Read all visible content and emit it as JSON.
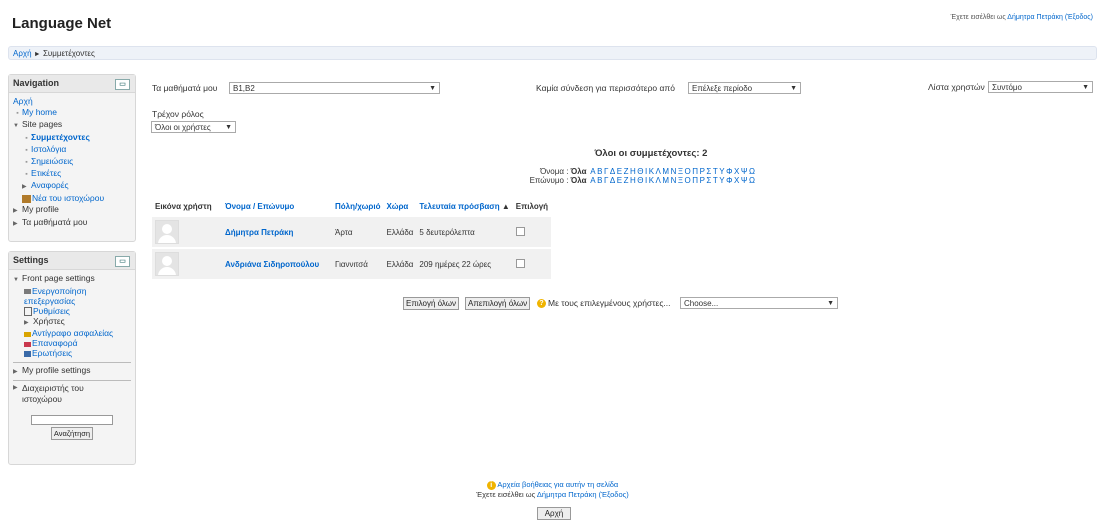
{
  "header": {
    "site_title": "Language Net",
    "login_prefix": "Έχετε εισέλθει ως",
    "login_user": "Δήμητρα Πετράκη",
    "logout": "(Έξοδος)"
  },
  "breadcrumb": {
    "home": "Αρχή",
    "sep": "►",
    "current": "Συμμετέχοντες"
  },
  "navigation": {
    "title": "Navigation",
    "home": "Αρχή",
    "my_home": "My home",
    "site_pages": "Site pages",
    "site_items": [
      "Συμμετέχοντες",
      "Ιστολόγια",
      "Σημειώσεις",
      "Ετικέτες",
      "Αναφορές",
      "Νέα του ιστοχώρου"
    ],
    "my_profile": "My profile",
    "my_courses": "Τα μαθήματά μου"
  },
  "settings": {
    "title": "Settings",
    "front_page_settings": "Front page settings",
    "items": [
      "Ενεργοποίηση επεξεργασίας",
      "Ρυθμίσεις",
      "Χρήστες",
      "Αντίγραφο ασφαλείας",
      "Επαναφορά",
      "Ερωτήσεις"
    ],
    "my_profile_settings": "My profile settings",
    "site_admin": "Διαχειριστής του ιστοχώρου",
    "search_button": "Αναζήτηση",
    "search_value": ""
  },
  "filters": {
    "courses_label": "Τα μαθήματά μου",
    "courses_value": "B1,B2",
    "inactive_label": "Καμία σύνδεση για περισσότερο από",
    "inactive_value": "Επέλεξε περίοδο",
    "userlist_label": "Λίστα χρηστών",
    "userlist_value": "Συντόμο",
    "role_label": "Τρέχον ρόλος",
    "role_value": "Όλοι οι χρήστες"
  },
  "summary": {
    "all_participants": "Όλοι οι συμμετέχοντες: 2",
    "firstname_label": "Όνομα :",
    "surname_label": "Επώνυμο :",
    "all": "Όλα",
    "letters": [
      "Α",
      "Β",
      "Γ",
      "Δ",
      "Ε",
      "Ζ",
      "Η",
      "Θ",
      "Ι",
      "Κ",
      "Λ",
      "Μ",
      "Ν",
      "Ξ",
      "Ο",
      "Π",
      "Ρ",
      "Σ",
      "Τ",
      "Υ",
      "Φ",
      "Χ",
      "Ψ",
      "Ω"
    ]
  },
  "table": {
    "headers": [
      "Εικόνα χρήστη",
      "Όνομα / Επώνυμο",
      "Πόλη/χωριό",
      "Χώρα",
      "Τελευταία πρόσβαση",
      "Επιλογή"
    ],
    "sort_arrow": "🡑",
    "rows": [
      {
        "name": "Δήμητρα Πετράκη",
        "city": "Άρτα",
        "country": "Ελλάδα",
        "last_access": "5 δευτερόλεπτα"
      },
      {
        "name": "Ανδριάνα Σιδηροπούλου",
        "city": "Γιαννιτσά",
        "country": "Ελλάδα",
        "last_access": "209 ημέρες 22 ώρες"
      }
    ]
  },
  "bulk": {
    "select_all": "Επιλογή όλων",
    "deselect_all": "Απεπιλογή όλων",
    "with_selected": "Με τους επιλεγμένους χρήστες...",
    "choose": "Choose..."
  },
  "footer": {
    "help_link": "Αρχεία βοήθειας για αυτήν τη σελίδα",
    "login_prefix": "Έχετε εισέλθει ως",
    "login_user": "Δήμητρα Πετράκη",
    "logout": "(Έξοδος)",
    "home_button": "Αρχή"
  }
}
